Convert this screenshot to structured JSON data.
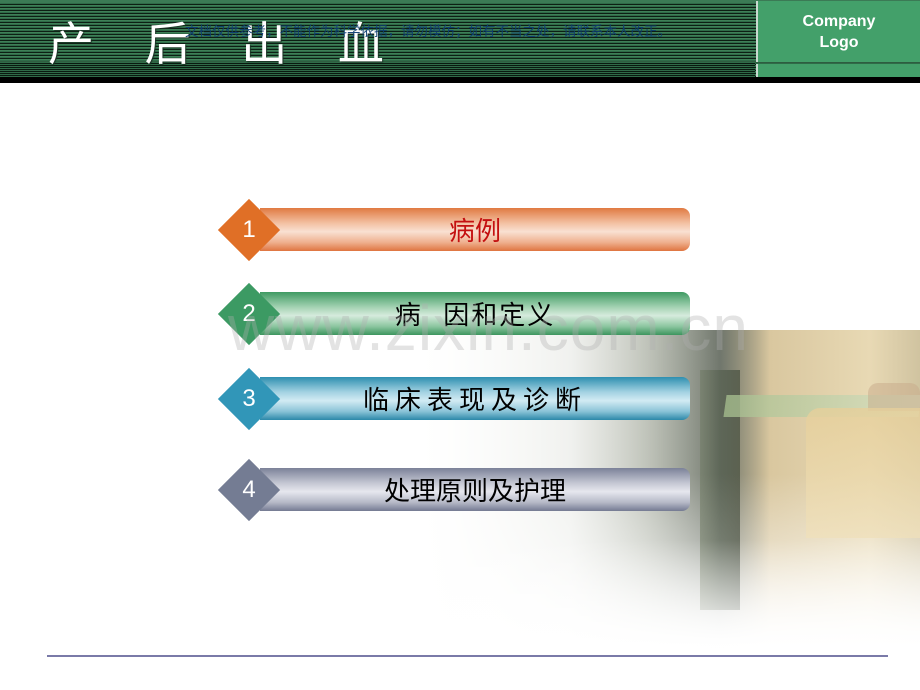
{
  "header": {
    "title": "产 后 出 血",
    "disclaimer": "文档仅供参考，不能作为科学依据，请勿模仿；如有不当之处，请联系本人改正。",
    "logo_text": "Company Logo",
    "colors": {
      "band": "#2f6b48",
      "logo_bg": "#43a06a",
      "disclaimer": "#0e3e72"
    }
  },
  "watermark": "www.zixin.com.cn",
  "menu": {
    "items": [
      {
        "number": "1",
        "label": "病例",
        "color": "#e06f26",
        "label_color": "#c41010"
      },
      {
        "number": "2",
        "label": "病  因和定义",
        "color": "#3c9a63",
        "label_color": "#000000"
      },
      {
        "number": "3",
        "label": "临床表现及诊断",
        "color": "#3196b8",
        "label_color": "#000000"
      },
      {
        "number": "4",
        "label": "处理原则及护理",
        "color": "#747c93",
        "label_color": "#000000"
      }
    ]
  },
  "footer": {
    "line_color": "#7a7aa8"
  }
}
